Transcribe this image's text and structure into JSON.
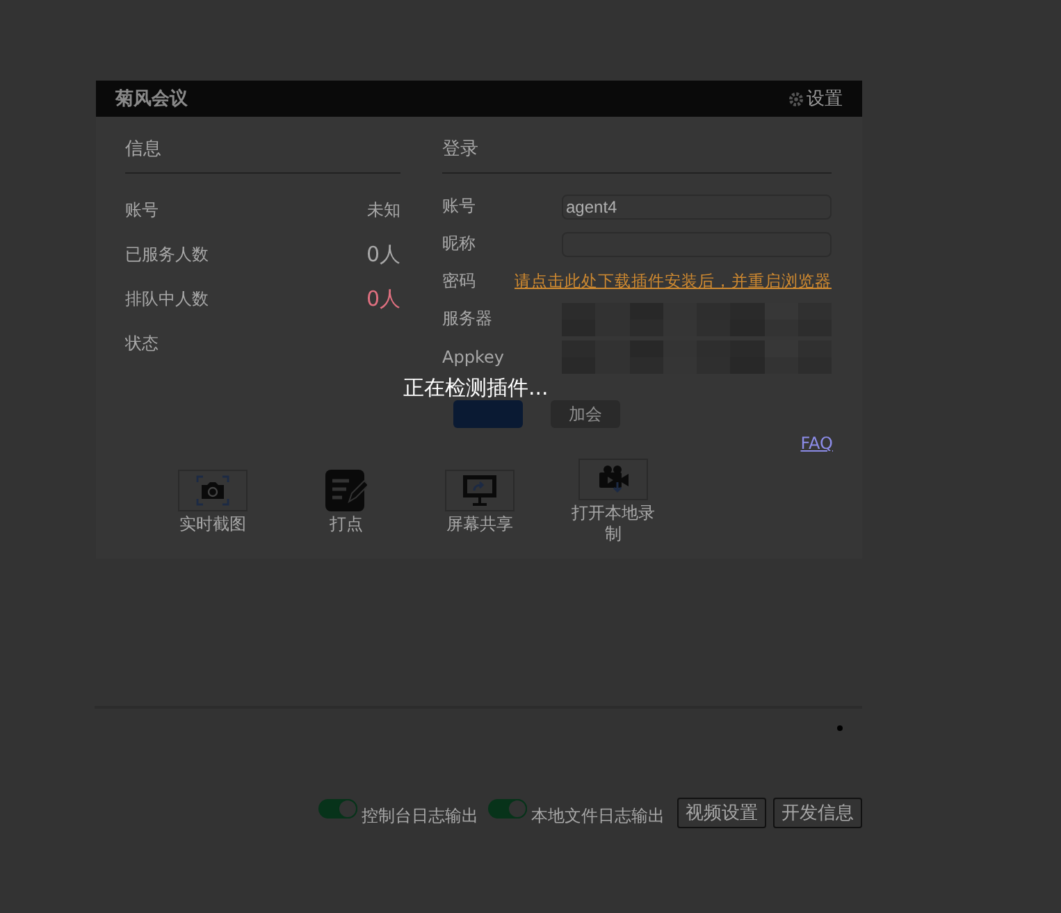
{
  "window": {
    "title": "菊风会议",
    "settings": "设置"
  },
  "info": {
    "title": "信息",
    "rows": [
      {
        "label": "账号",
        "value": "未知"
      },
      {
        "label": "已服务人数",
        "value": "0人",
        "kind": "count"
      },
      {
        "label": "排队中人数",
        "value": "0人",
        "kind": "alert"
      },
      {
        "label": "状态"
      }
    ]
  },
  "login": {
    "title": "登录",
    "fields": [
      {
        "label": "账号",
        "kind": "input",
        "value": "agent4"
      },
      {
        "label": "昵称",
        "kind": "input"
      },
      {
        "label": "密码",
        "kind": "link",
        "value": "请点击此处下载插件安装后，并重启浏览器"
      },
      {
        "label": "服务器",
        "kind": "redacted"
      },
      {
        "label": "Appkey",
        "kind": "redacted"
      }
    ],
    "buttons": [
      {
        "kind": "primary"
      },
      {
        "kind": "disabled",
        "label": "加会"
      }
    ]
  },
  "faq": "FAQ",
  "tools": [
    {
      "kind": "camera",
      "label": "实时截图"
    },
    {
      "kind": "note",
      "label": "打点"
    },
    {
      "kind": "monitor",
      "label": "屏幕共享"
    },
    {
      "kind": "video",
      "label": "打开本地录制"
    }
  ],
  "footer": {
    "toggles": [
      {
        "label": "控制台日志输出",
        "on": true
      },
      {
        "label": "本地文件日志输出",
        "on": true
      }
    ],
    "buttons": [
      "视频设置",
      "开发信息"
    ]
  },
  "loading": "正在检测插件..."
}
